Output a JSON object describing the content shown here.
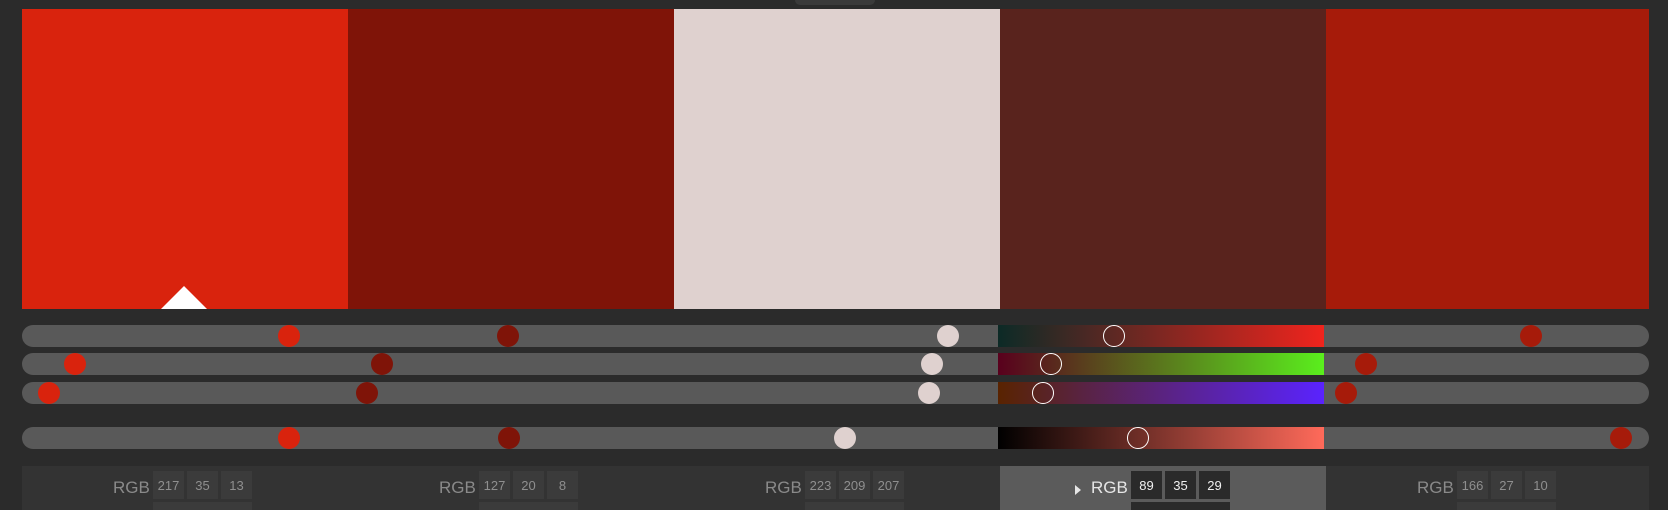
{
  "swatches": [
    {
      "hex": "#d9230d",
      "rgb": [
        "217",
        "35",
        "13"
      ]
    },
    {
      "hex": "#7f1408",
      "rgb": [
        "127",
        "20",
        "8"
      ]
    },
    {
      "hex": "#dfd1cf",
      "rgb": [
        "223",
        "209",
        "207"
      ]
    },
    {
      "hex": "#59231d",
      "rgb": [
        "89",
        "35",
        "29"
      ]
    },
    {
      "hex": "#a61b0a",
      "rgb": [
        "166",
        "27",
        "10"
      ]
    }
  ],
  "base_swatch_index": 0,
  "active_swatch_index": 3,
  "mode_label": "RGB",
  "icons": {
    "base_marker": "base-color-triangle-icon",
    "expand": "disclosure-triangle-icon"
  },
  "channel_gradients": {
    "red": [
      "#0c2a26",
      "#f0241d"
    ],
    "green": [
      "#59001d",
      "#5aee1d"
    ],
    "blue": [
      "#592300",
      "#5a23fe"
    ],
    "brightness": [
      "#000000",
      "#ff6a5a"
    ]
  }
}
